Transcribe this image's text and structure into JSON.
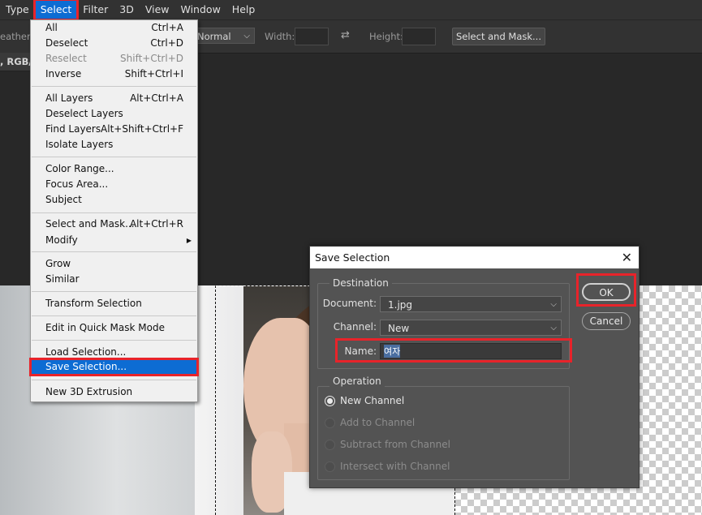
{
  "menubar": {
    "items": [
      "Type",
      "Select",
      "Filter",
      "3D",
      "View",
      "Window",
      "Help"
    ],
    "active": "Select"
  },
  "options_bar": {
    "feather_label": "eather:",
    "style_value": "Normal",
    "width_label": "Width:",
    "height_label": "Height:",
    "select_mask_button": "Select and Mask..."
  },
  "doc_tab": {
    "title": ", RGB/"
  },
  "select_menu": {
    "items": [
      {
        "label": "All",
        "shortcut": "Ctrl+A"
      },
      {
        "label": "Deselect",
        "shortcut": "Ctrl+D"
      },
      {
        "label": "Reselect",
        "shortcut": "Shift+Ctrl+D",
        "disabled": true
      },
      {
        "label": "Inverse",
        "shortcut": "Shift+Ctrl+I"
      },
      {
        "label": "All Layers",
        "shortcut": "Alt+Ctrl+A"
      },
      {
        "label": "Deselect Layers",
        "shortcut": ""
      },
      {
        "label": "Find Layers",
        "shortcut": "Alt+Shift+Ctrl+F"
      },
      {
        "label": "Isolate Layers",
        "shortcut": ""
      },
      {
        "label": "Color Range...",
        "shortcut": ""
      },
      {
        "label": "Focus Area...",
        "shortcut": ""
      },
      {
        "label": "Subject",
        "shortcut": ""
      },
      {
        "label": "Select and Mask...",
        "shortcut": "Alt+Ctrl+R"
      },
      {
        "label": "Modify",
        "shortcut": ""
      },
      {
        "label": "Grow",
        "shortcut": ""
      },
      {
        "label": "Similar",
        "shortcut": ""
      },
      {
        "label": "Transform Selection",
        "shortcut": ""
      },
      {
        "label": "Edit in Quick Mask Mode",
        "shortcut": ""
      },
      {
        "label": "Load Selection...",
        "shortcut": ""
      },
      {
        "label": "Save Selection...",
        "shortcut": "",
        "highlighted": true
      },
      {
        "label": "New 3D Extrusion",
        "shortcut": ""
      }
    ]
  },
  "save_selection_dialog": {
    "title": "Save Selection",
    "destination": {
      "group_label": "Destination",
      "document_label": "Document:",
      "document_value": "1.jpg",
      "channel_label": "Channel:",
      "channel_value": "New",
      "name_label": "Name:",
      "name_value": "여자"
    },
    "operation": {
      "group_label": "Operation",
      "options": [
        {
          "label": "New Channel",
          "selected": true,
          "disabled": false
        },
        {
          "label": "Add to Channel",
          "selected": false,
          "disabled": true
        },
        {
          "label": "Subtract from Channel",
          "selected": false,
          "disabled": true
        },
        {
          "label": "Intersect with Channel",
          "selected": false,
          "disabled": true
        }
      ]
    },
    "ok_label": "OK",
    "cancel_label": "Cancel"
  },
  "colors": {
    "highlight_blue": "#0d6cd3",
    "annotation_red": "#e8232a",
    "dialog_gray": "#535353"
  }
}
